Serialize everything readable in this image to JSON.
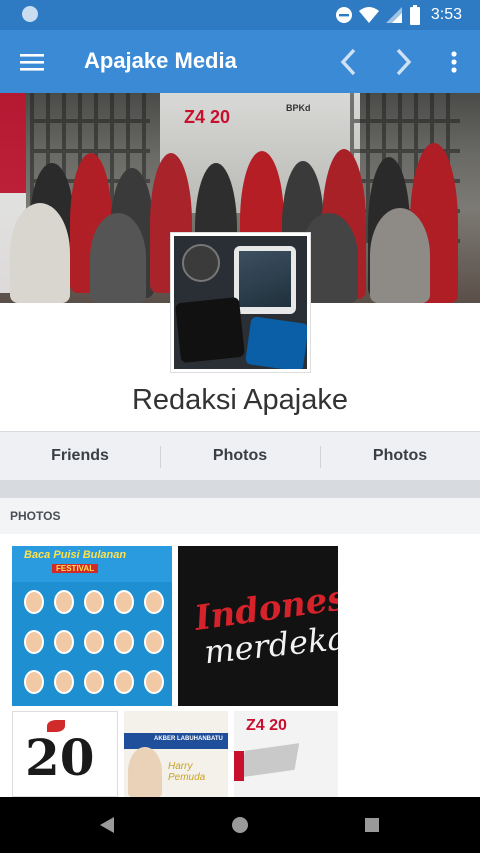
{
  "status_bar": {
    "time": "3:53"
  },
  "app_bar": {
    "title": "Apajake Media",
    "menu_icon": "hamburger-menu-icon",
    "back_icon": "chevron-left-icon",
    "forward_icon": "chevron-right-icon",
    "overflow_icon": "more-vert-icon"
  },
  "cover": {
    "banner_text": "Z4 20",
    "banner_sub": "BPKd"
  },
  "profile": {
    "name": "Redaksi Apajake"
  },
  "tabs": [
    {
      "label": "Friends"
    },
    {
      "label": "Photos"
    },
    {
      "label": "Photos"
    }
  ],
  "photos_section": {
    "header": "PHOTOS"
  },
  "photos": {
    "p1_title": "Baca Puisi Bulanan",
    "p1_sub": "FESTIVAL",
    "p2_line1": "Indonesia",
    "p2_line2": "merdeka",
    "p3_text": "20",
    "p4_band": "AKBER LABUHANBATU",
    "p4_script": "Harry Pemuda",
    "p5_logo": "Z4 20"
  },
  "colors": {
    "status_bar": "#2e7bc4",
    "app_bar": "#3a8ad6",
    "tab_bg": "#eef0f3",
    "nav_bar": "#000000"
  }
}
